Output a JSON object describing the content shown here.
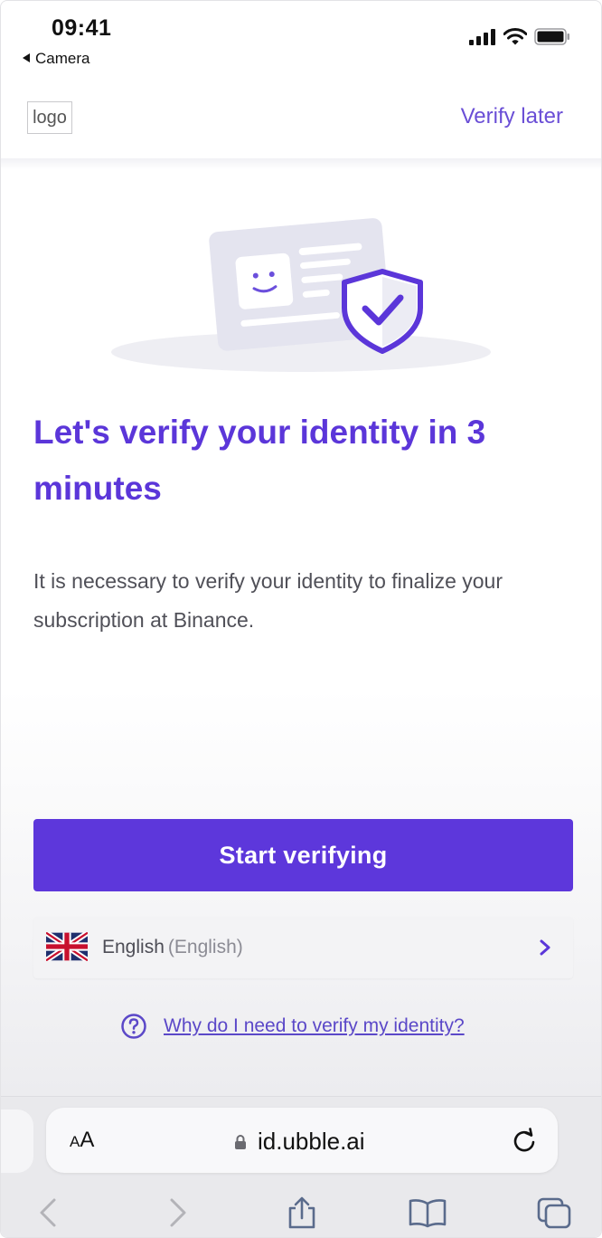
{
  "status_bar": {
    "time": "09:41",
    "back_label": "Camera"
  },
  "header": {
    "logo_text": "logo",
    "verify_later": "Verify later"
  },
  "main": {
    "title": "Let's verify your identity in 3 minutes",
    "description": "It is necessary to verify your identity to finalize your subscription at Binance."
  },
  "actions": {
    "start_button": "Start verifying",
    "language": "English",
    "language_native": "(English)",
    "help_link": "Why do I need to verify my identity?"
  },
  "browser": {
    "aa_label": "A",
    "aa_small": "A",
    "url": "id.ubble.ai"
  },
  "colors": {
    "accent": "#5d37db",
    "link": "#6a4ed6"
  }
}
